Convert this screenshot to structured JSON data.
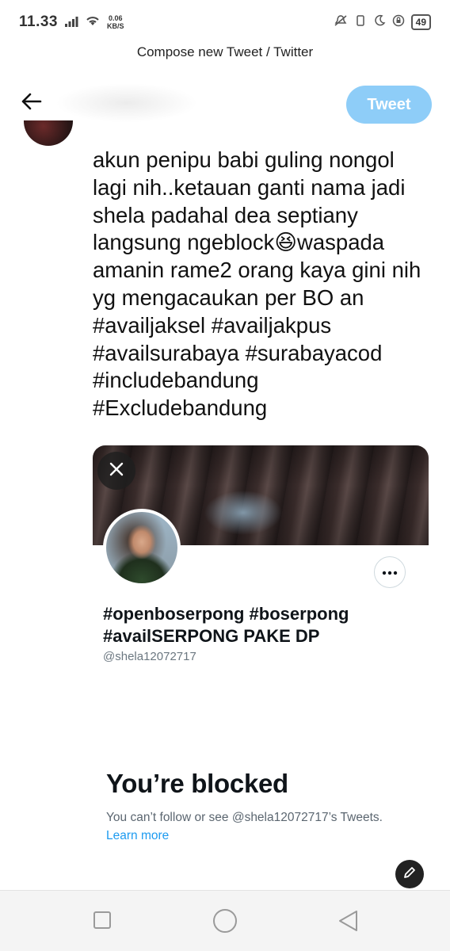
{
  "status_bar": {
    "time": "11.33",
    "net_speed_value": "0.06",
    "net_speed_unit": "KB/S",
    "battery": "49"
  },
  "page_title": "Compose new Tweet / Twitter",
  "compose": {
    "tweet_button_label": "Tweet",
    "tweet_text": "akun penipu babi guling nongol lagi nih..ketauan ganti nama jadi shela padahal dea septiany langsung ngeblock😆waspada amanin rame2 orang kaya gini nih yg mengacaukan per BO an #availjaksel #availjakpus #availsurabaya #surabayacod #includebandung #Excludebandung"
  },
  "profile_card": {
    "display_name": "#openboserpong #boserpong #availSERPONG PAKE DP",
    "handle": "@shela12072717",
    "blocked_title": "You’re blocked",
    "blocked_description": "You can’t follow or see @shela12072717’s Tweets.",
    "learn_more_label": "Learn more"
  },
  "colors": {
    "accent": "#1d9bf0",
    "tweet_button_disabled": "#8ecdf8",
    "text_primary": "#0f1419",
    "text_secondary": "#5b6670"
  },
  "icons": {
    "back": "arrow-left-icon",
    "close": "close-icon",
    "more": "more-horizontal-icon",
    "compose_fab": "pen-icon",
    "nav_recent": "square-icon",
    "nav_home": "circle-icon",
    "nav_back": "triangle-back-icon"
  }
}
